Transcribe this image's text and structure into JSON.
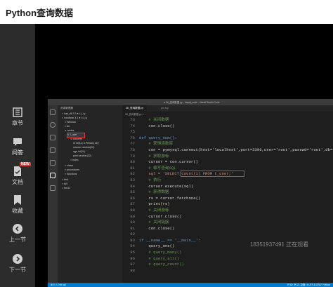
{
  "page": {
    "title": "Python查询数据"
  },
  "sidebar": {
    "items": [
      {
        "label": "章节",
        "icon": "chapters-icon"
      },
      {
        "label": "问答",
        "icon": "qa-icon"
      },
      {
        "label": "文档",
        "icon": "document-icon",
        "badge": "NEW"
      },
      {
        "label": "收藏",
        "icon": "bookmark-icon"
      },
      {
        "label": "上一节",
        "icon": "chevron-left-icon"
      },
      {
        "label": "下一节",
        "icon": "chevron-right-icon"
      }
    ]
  },
  "vscode": {
    "menu": [
      "文件(F)",
      "编辑(E)",
      "选择(S)",
      "查看(V)",
      "转到(G)",
      "运行(R)",
      "终端(T)",
      "帮助(H)"
    ],
    "window_title": "● 06_查询数据.py - mysql_code - Visual Studio Code",
    "explorer": {
      "header": "资源管理器",
      "rows": [
        "> has_dll  3.3 ● t-t_i.y",
        "> localhost  3.1 ● t-t_i.y",
        "> Window",
        "> All",
        "∨ nodes",
        "∨ t_user",
        "∨ columns",
        "id  int(11) 4 Primary key",
        "uname  varchar(20)",
        "age  int(11)",
        "pwd  varchar(32)",
        "> index",
        "> views",
        "> procedures",
        "> functions",
        "> test",
        "> tp5",
        "> tp612"
      ],
      "selected_index": 5
    },
    "tabs": [
      {
        "label": "06_查询数据.py",
        "active": true
      },
      {
        "label": "pm.sql",
        "active": false
      }
    ],
    "breadcrumb": "06_查询数据.py > ...",
    "code_lines": [
      {
        "n": "73",
        "text": "    # 关闭数据"
      },
      {
        "n": "74",
        "text": "    con.close()"
      },
      {
        "n": "75",
        "text": ""
      },
      {
        "n": "76",
        "text": "def query_num():"
      },
      {
        "n": "77",
        "text": "    # 获得连数库"
      },
      {
        "n": "78",
        "text": "    con = pymysql.connect(host='localhost',port=3306,user='root',passwd='root',db='xt'"
      },
      {
        "n": "79",
        "text": "    # 获取游标"
      },
      {
        "n": "80",
        "text": "    cursor = con.cursor()"
      },
      {
        "n": "81",
        "text": "    # 编写查询SQL"
      },
      {
        "n": "82",
        "text": "    sql = 'SELECT count(1) FROM t_user;'"
      },
      {
        "n": "83",
        "text": "    # 执行"
      },
      {
        "n": "84",
        "text": "    cursor.execute(sql)"
      },
      {
        "n": "85",
        "text": "    # 获得数据"
      },
      {
        "n": "86",
        "text": "    rs = cursor.fetchone()"
      },
      {
        "n": "87",
        "text": "    print(rs)"
      },
      {
        "n": "88",
        "text": "    # 关闭游标"
      },
      {
        "n": "89",
        "text": "    cursor.close()"
      },
      {
        "n": "90",
        "text": "    # 关闭链接"
      },
      {
        "n": "91",
        "text": "    con.close()"
      },
      {
        "n": "92",
        "text": ""
      },
      {
        "n": "93",
        "text": "if __name__ == '__main__':"
      },
      {
        "n": "94",
        "text": "    query_one()"
      },
      {
        "n": "95",
        "text": "    # query_many()"
      },
      {
        "n": "96",
        "text": "    # query_all()"
      },
      {
        "n": "97",
        "text": "    # query_count()"
      },
      {
        "n": "98",
        "text": ""
      }
    ],
    "status_left": "⊗ 0 ⚠ 0  ⊕ sql",
    "status_right": "行 82, 列 21  空格: 4  UTF-8  CRLF  Python"
  },
  "watermark": "18351937491 正在观看",
  "colors": {
    "sidebar_bg": "#2c2c2c",
    "statusbar": "#007acc",
    "highlight": "#e53935",
    "badge": "#e53935"
  }
}
